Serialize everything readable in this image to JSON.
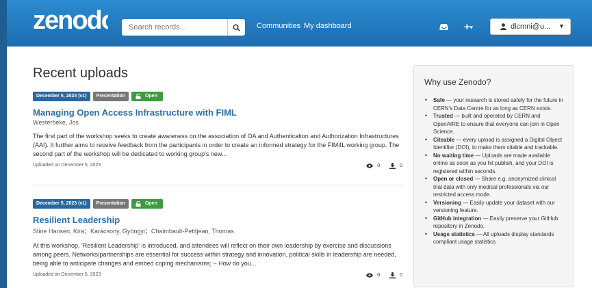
{
  "brand": {
    "logo_text": "zenodo"
  },
  "search": {
    "placeholder": "Search records..."
  },
  "nav": {
    "communities": "Communities",
    "dashboard": "My dashboard"
  },
  "user": {
    "email": "dlcmni@u..."
  },
  "icons": {
    "search": "search-icon",
    "inbox": "inbox-icon",
    "plus": "plus-icon",
    "user": "user-icon",
    "lock": "unlock-icon",
    "eye": "eye-icon",
    "download": "download-icon",
    "colors": {
      "navbar": "#1d6db0",
      "date_badge": "#29679e",
      "type_badge": "#777777",
      "open_badge": "#3f9a40",
      "title_link": "#2a6fab"
    }
  },
  "main": {
    "heading": "Recent uploads"
  },
  "records": [
    {
      "date_badge": "December 5, 2023 (v1)",
      "type_badge": "Presentation",
      "access_badge": "Open",
      "title": "Managing Open Access Infrastructure with FIML",
      "authors": "Westerbeke, Jos",
      "description": "The first part of the workshop seeks to create awareness on the association of OA and Authentication and Authorization Infrastructures (AAI). It further aims to receive feedback from the participants in order to create an informed strategy for the FIM4L working group. The second part of the workshop will be dedicated to working group's new...",
      "uploaded": "Uploaded on December 5, 2023",
      "views": "0",
      "downloads": "0"
    },
    {
      "date_badge": "December 5, 2023 (v1)",
      "type_badge": "Presentation",
      "access_badge": "Open",
      "title": "Resilient Leadership",
      "authors": "Stine Hansen, Kira；Karácsony, Gyöngyi；Chaimbault-Petitjean, Thomas",
      "description": "At this workshop, 'Resilient Leadership' is introduced, and attendees will reflect on their own leadership by exercise and discussions among peers.  Networks/partnerships are essential for success within strategy and innovation, political skills in leadership are needed, being able to anticipate changes and embed coping mechanisms; – How do you...",
      "uploaded": "Uploaded on December 5, 2023",
      "views": "0",
      "downloads": "0"
    }
  ],
  "sidebar": {
    "title": "Why use Zenodo?",
    "items": [
      {
        "term": "Safe",
        "text": " — your research is stored safely for the future in CERN's Data Centre for as long as CERN exists."
      },
      {
        "term": "Trusted",
        "text": " — built and operated by CERN and OpenAIRE to ensure that everyone can join in Open Science."
      },
      {
        "term": "Citeable",
        "text": " — every upload is assigned a Digital Object Identifier (DOI), to make them citable and trackable."
      },
      {
        "term": "No waiting time",
        "text": " — Uploads are made available online as soon as you hit publish, and your DOI is registered within seconds."
      },
      {
        "term": "Open or closed",
        "text": " — Share e.g. anonymized clinical trial data with only medical professionals via our restricted access mode."
      },
      {
        "term": "Versioning",
        "text": " — Easily update your dataset with our versioning feature."
      },
      {
        "term": "GitHub integration",
        "text": " — Easily preserve your GitHub repository in Zenodo."
      },
      {
        "term": "Usage statistics",
        "text": " — All uploads display standards compliant usage statistics"
      }
    ]
  }
}
